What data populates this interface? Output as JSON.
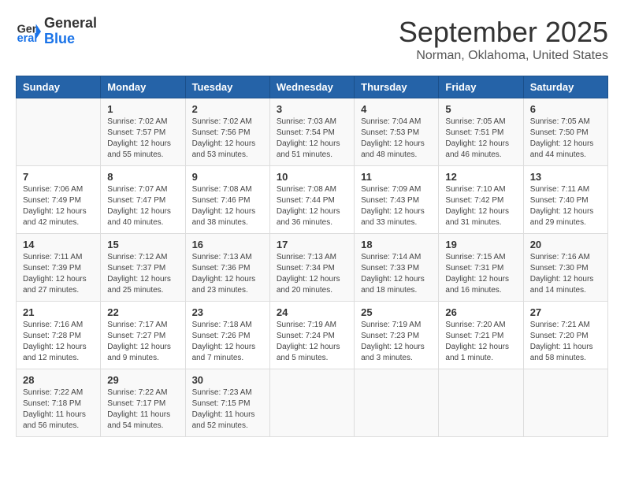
{
  "header": {
    "logo_general": "General",
    "logo_blue": "Blue",
    "title": "September 2025",
    "subtitle": "Norman, Oklahoma, United States"
  },
  "days_of_week": [
    "Sunday",
    "Monday",
    "Tuesday",
    "Wednesday",
    "Thursday",
    "Friday",
    "Saturday"
  ],
  "weeks": [
    [
      {
        "num": "",
        "info": ""
      },
      {
        "num": "1",
        "info": "Sunrise: 7:02 AM\nSunset: 7:57 PM\nDaylight: 12 hours and 55 minutes."
      },
      {
        "num": "2",
        "info": "Sunrise: 7:02 AM\nSunset: 7:56 PM\nDaylight: 12 hours and 53 minutes."
      },
      {
        "num": "3",
        "info": "Sunrise: 7:03 AM\nSunset: 7:54 PM\nDaylight: 12 hours and 51 minutes."
      },
      {
        "num": "4",
        "info": "Sunrise: 7:04 AM\nSunset: 7:53 PM\nDaylight: 12 hours and 48 minutes."
      },
      {
        "num": "5",
        "info": "Sunrise: 7:05 AM\nSunset: 7:51 PM\nDaylight: 12 hours and 46 minutes."
      },
      {
        "num": "6",
        "info": "Sunrise: 7:05 AM\nSunset: 7:50 PM\nDaylight: 12 hours and 44 minutes."
      }
    ],
    [
      {
        "num": "7",
        "info": "Sunrise: 7:06 AM\nSunset: 7:49 PM\nDaylight: 12 hours and 42 minutes."
      },
      {
        "num": "8",
        "info": "Sunrise: 7:07 AM\nSunset: 7:47 PM\nDaylight: 12 hours and 40 minutes."
      },
      {
        "num": "9",
        "info": "Sunrise: 7:08 AM\nSunset: 7:46 PM\nDaylight: 12 hours and 38 minutes."
      },
      {
        "num": "10",
        "info": "Sunrise: 7:08 AM\nSunset: 7:44 PM\nDaylight: 12 hours and 36 minutes."
      },
      {
        "num": "11",
        "info": "Sunrise: 7:09 AM\nSunset: 7:43 PM\nDaylight: 12 hours and 33 minutes."
      },
      {
        "num": "12",
        "info": "Sunrise: 7:10 AM\nSunset: 7:42 PM\nDaylight: 12 hours and 31 minutes."
      },
      {
        "num": "13",
        "info": "Sunrise: 7:11 AM\nSunset: 7:40 PM\nDaylight: 12 hours and 29 minutes."
      }
    ],
    [
      {
        "num": "14",
        "info": "Sunrise: 7:11 AM\nSunset: 7:39 PM\nDaylight: 12 hours and 27 minutes."
      },
      {
        "num": "15",
        "info": "Sunrise: 7:12 AM\nSunset: 7:37 PM\nDaylight: 12 hours and 25 minutes."
      },
      {
        "num": "16",
        "info": "Sunrise: 7:13 AM\nSunset: 7:36 PM\nDaylight: 12 hours and 23 minutes."
      },
      {
        "num": "17",
        "info": "Sunrise: 7:13 AM\nSunset: 7:34 PM\nDaylight: 12 hours and 20 minutes."
      },
      {
        "num": "18",
        "info": "Sunrise: 7:14 AM\nSunset: 7:33 PM\nDaylight: 12 hours and 18 minutes."
      },
      {
        "num": "19",
        "info": "Sunrise: 7:15 AM\nSunset: 7:31 PM\nDaylight: 12 hours and 16 minutes."
      },
      {
        "num": "20",
        "info": "Sunrise: 7:16 AM\nSunset: 7:30 PM\nDaylight: 12 hours and 14 minutes."
      }
    ],
    [
      {
        "num": "21",
        "info": "Sunrise: 7:16 AM\nSunset: 7:28 PM\nDaylight: 12 hours and 12 minutes."
      },
      {
        "num": "22",
        "info": "Sunrise: 7:17 AM\nSunset: 7:27 PM\nDaylight: 12 hours and 9 minutes."
      },
      {
        "num": "23",
        "info": "Sunrise: 7:18 AM\nSunset: 7:26 PM\nDaylight: 12 hours and 7 minutes."
      },
      {
        "num": "24",
        "info": "Sunrise: 7:19 AM\nSunset: 7:24 PM\nDaylight: 12 hours and 5 minutes."
      },
      {
        "num": "25",
        "info": "Sunrise: 7:19 AM\nSunset: 7:23 PM\nDaylight: 12 hours and 3 minutes."
      },
      {
        "num": "26",
        "info": "Sunrise: 7:20 AM\nSunset: 7:21 PM\nDaylight: 12 hours and 1 minute."
      },
      {
        "num": "27",
        "info": "Sunrise: 7:21 AM\nSunset: 7:20 PM\nDaylight: 11 hours and 58 minutes."
      }
    ],
    [
      {
        "num": "28",
        "info": "Sunrise: 7:22 AM\nSunset: 7:18 PM\nDaylight: 11 hours and 56 minutes."
      },
      {
        "num": "29",
        "info": "Sunrise: 7:22 AM\nSunset: 7:17 PM\nDaylight: 11 hours and 54 minutes."
      },
      {
        "num": "30",
        "info": "Sunrise: 7:23 AM\nSunset: 7:15 PM\nDaylight: 11 hours and 52 minutes."
      },
      {
        "num": "",
        "info": ""
      },
      {
        "num": "",
        "info": ""
      },
      {
        "num": "",
        "info": ""
      },
      {
        "num": "",
        "info": ""
      }
    ]
  ]
}
